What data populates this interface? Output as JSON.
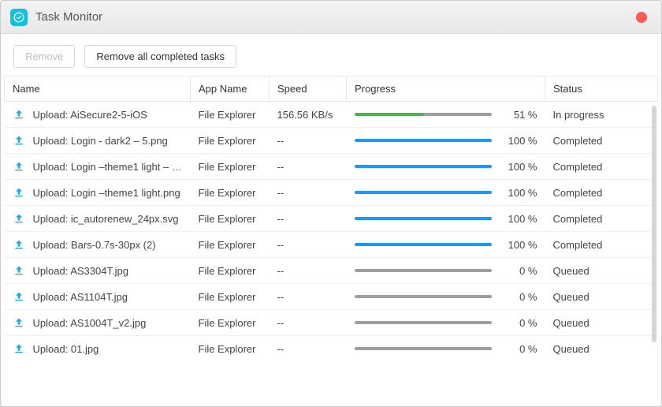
{
  "header": {
    "title": "Task Monitor",
    "icon": "check-circle-icon",
    "close_color": "#ff5a52"
  },
  "toolbar": {
    "remove_label": "Remove",
    "remove_all_label": "Remove all completed tasks"
  },
  "columns": {
    "name": "Name",
    "app": "App Name",
    "speed": "Speed",
    "progress": "Progress",
    "status": "Status"
  },
  "progress_colors": {
    "in_progress": "#4caf50",
    "complete": "#2196f3",
    "track": "#9e9e9e"
  },
  "tasks": [
    {
      "name": "Upload: AiSecure2-5-iOS",
      "app": "File Explorer",
      "speed": "156.56 KB/s",
      "percent": 51,
      "percent_label": "51 %",
      "status": "In progress",
      "bar": "green"
    },
    {
      "name": "Upload: Login - dark2 – 5.png",
      "app": "File Explorer",
      "speed": "--",
      "percent": 100,
      "percent_label": "100 %",
      "status": "Completed",
      "bar": "blue"
    },
    {
      "name": "Upload: Login –theme1 light – 1....",
      "app": "File Explorer",
      "speed": "--",
      "percent": 100,
      "percent_label": "100 %",
      "status": "Completed",
      "bar": "blue"
    },
    {
      "name": "Upload: Login –theme1 light.png",
      "app": "File Explorer",
      "speed": "--",
      "percent": 100,
      "percent_label": "100 %",
      "status": "Completed",
      "bar": "blue"
    },
    {
      "name": "Upload: ic_autorenew_24px.svg",
      "app": "File Explorer",
      "speed": "--",
      "percent": 100,
      "percent_label": "100 %",
      "status": "Completed",
      "bar": "blue"
    },
    {
      "name": "Upload: Bars-0.7s-30px (2)",
      "app": "File Explorer",
      "speed": "--",
      "percent": 100,
      "percent_label": "100 %",
      "status": "Completed",
      "bar": "blue"
    },
    {
      "name": "Upload: AS3304T.jpg",
      "app": "File Explorer",
      "speed": "--",
      "percent": 0,
      "percent_label": "0 %",
      "status": "Queued",
      "bar": "none"
    },
    {
      "name": "Upload: AS1104T.jpg",
      "app": "File Explorer",
      "speed": "--",
      "percent": 0,
      "percent_label": "0 %",
      "status": "Queued",
      "bar": "none"
    },
    {
      "name": "Upload: AS1004T_v2.jpg",
      "app": "File Explorer",
      "speed": "--",
      "percent": 0,
      "percent_label": "0 %",
      "status": "Queued",
      "bar": "none"
    },
    {
      "name": "Upload: 01.jpg",
      "app": "File Explorer",
      "speed": "--",
      "percent": 0,
      "percent_label": "0 %",
      "status": "Queued",
      "bar": "none"
    }
  ]
}
